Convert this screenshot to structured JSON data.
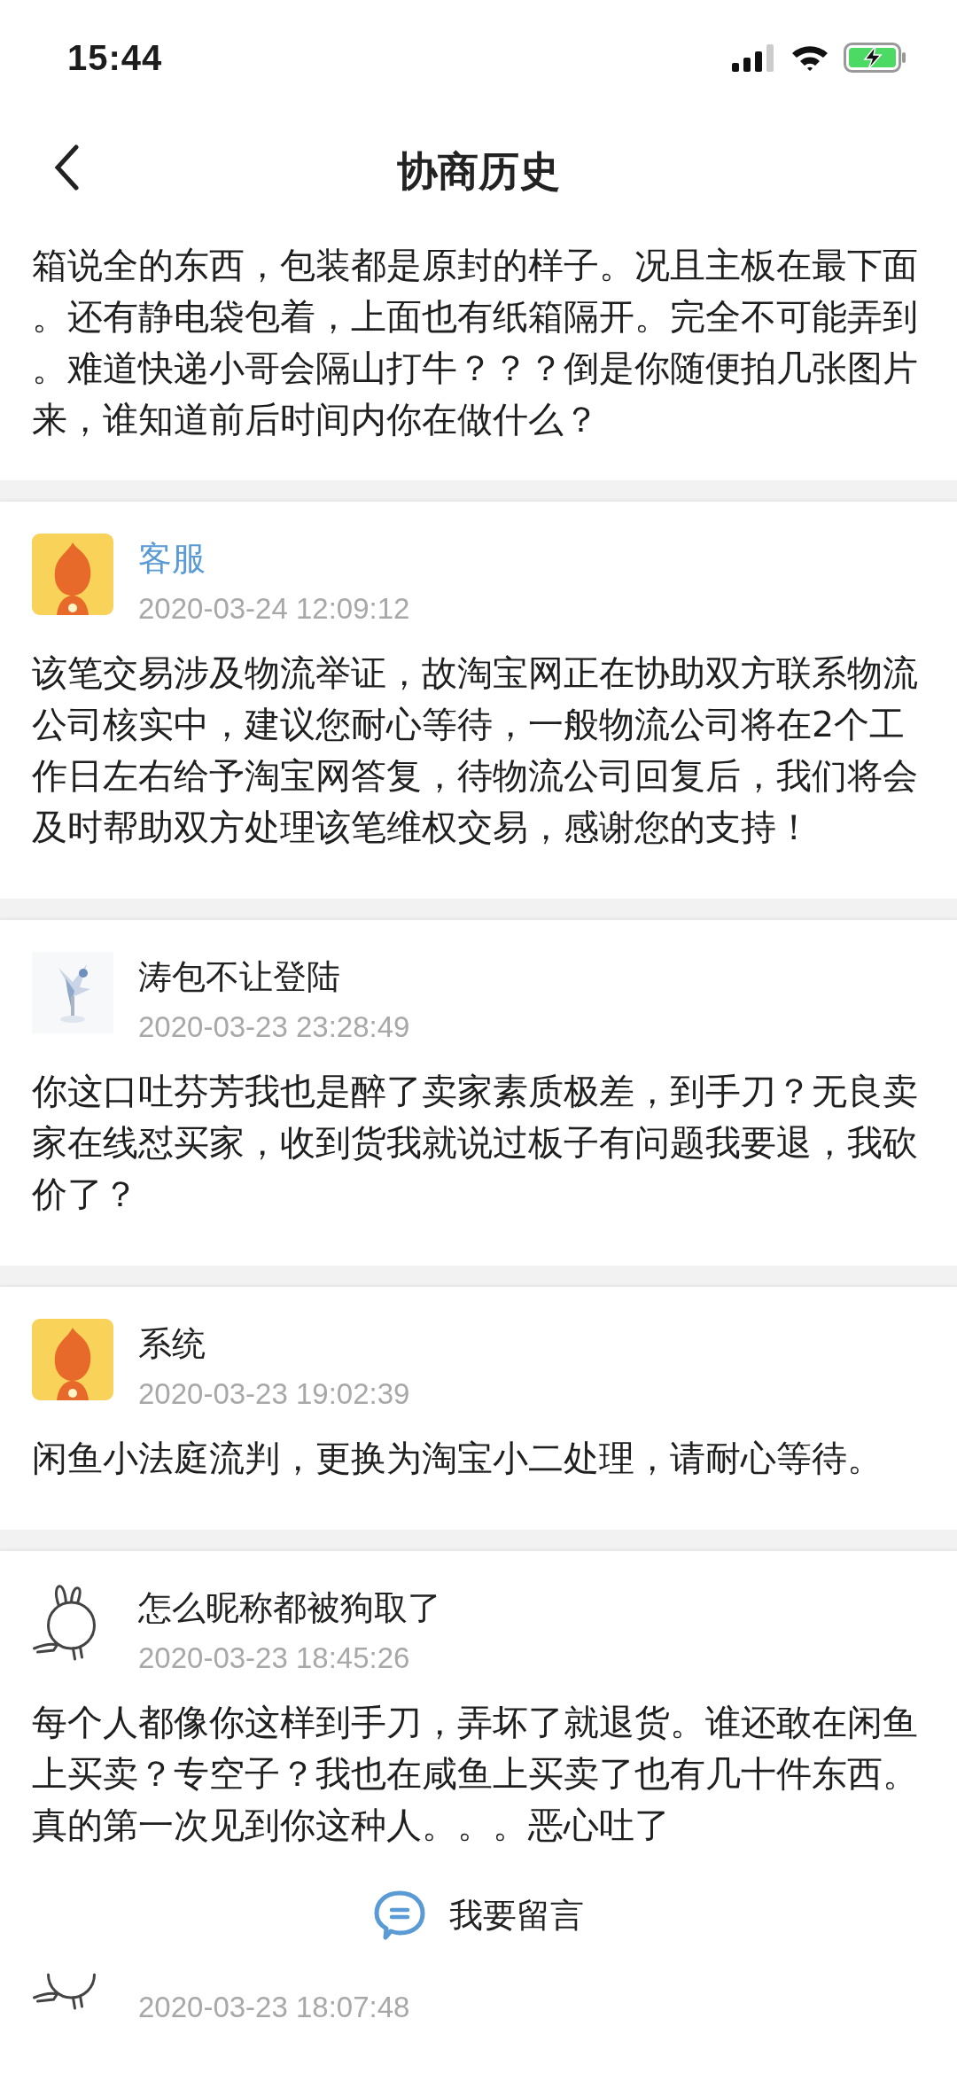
{
  "status_bar": {
    "time": "15:44"
  },
  "nav": {
    "title": "协商历史"
  },
  "partial_top": {
    "text": "箱说全的东西，包装都是原封的样子。况且主板在最下面。还有静电袋包着，上面也有纸箱隔开。完全不可能弄到。难道快递小哥会隔山打牛？？？倒是你随便拍几张图片来，谁知道前后时间内你在做什么？"
  },
  "messages": [
    {
      "kind": "staff",
      "avatar": {
        "kind": "mascot"
      },
      "name": "客服",
      "time": "2020-03-24 12:09:12",
      "text": "该笔交易涉及物流举证，故淘宝网正在协助双方联系物流公司核实中，建议您耐心等待，一般物流公司将在2个工作日左右给予淘宝网答复，待物流公司回复后，我们将会及时帮助双方处理该笔维权交易，感谢您的支持！"
    },
    {
      "kind": "user",
      "name": "涛包不让登陆",
      "time": "2020-03-23 23:28:49",
      "text": "你这口吐芬芳我也是醉了卖家素质极差，到手刀？无良卖家在线怼买家，收到货我就说过板子有问题我要退，我砍价了？"
    },
    {
      "kind": "user",
      "avatar": {
        "kind": "mascot"
      },
      "name": "系统",
      "time": "2020-03-23 19:02:39",
      "text": "闲鱼小法庭流判，更换为淘宝小二处理，请耐心等待。"
    },
    {
      "kind": "user",
      "avatar": {
        "kind": "bunny"
      },
      "name": "怎么昵称都被狗取了",
      "time": "2020-03-23 18:45:26",
      "text": "每个人都像你这样到手刀，弄坏了就退货。谁还敢在闲鱼上买卖？专空子？我也在咸鱼上买卖了也有几十件东西。真的第一次见到你这种人。。。恶心吐了"
    },
    {
      "kind": "user",
      "avatar": {
        "kind": "bunny"
      },
      "time": "2020-03-23 18:07:48"
    }
  ],
  "comment_button": {
    "label": "我要留言"
  }
}
